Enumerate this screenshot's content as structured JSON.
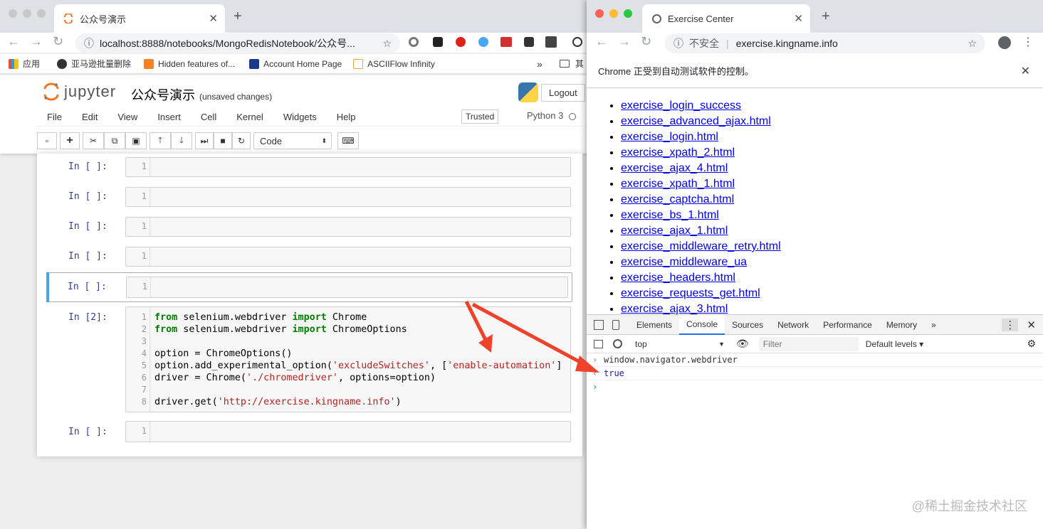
{
  "left": {
    "tab_title": "公众号演示",
    "url": "localhost:8888/notebooks/MongoRedisNotebook/公众号...",
    "bookmarks": [
      "应用",
      "亚马逊批量删除",
      "Hidden features of...",
      "Account Home Page",
      "ASCIIFlow Infinity"
    ],
    "bookmarks_more": "»",
    "other_bookmarks": "其",
    "jupyter": {
      "logo_text": "jupyter",
      "notebook_title": "公众号演示",
      "save_status": "(unsaved changes)",
      "logout": "Logout",
      "menu": [
        "File",
        "Edit",
        "View",
        "Insert",
        "Cell",
        "Kernel",
        "Widgets",
        "Help"
      ],
      "trusted": "Trusted",
      "kernel": "Python 3",
      "cell_type": "Code"
    },
    "cells": [
      {
        "prompt": "In [ ]:",
        "line": "1"
      },
      {
        "prompt": "In [ ]:",
        "line": "1"
      },
      {
        "prompt": "In [ ]:",
        "line": "1"
      },
      {
        "prompt": "In [ ]:",
        "line": "1"
      },
      {
        "prompt": "In [ ]:",
        "line": "1"
      },
      {
        "prompt": "In [2]:",
        "lines": [
          "1",
          "2",
          "3",
          "4",
          "5",
          "6",
          "7",
          "8"
        ]
      },
      {
        "prompt": "In [ ]:",
        "line": "1"
      }
    ],
    "code": {
      "l1_kw1": "from",
      "l1_mod": " selenium.webdriver ",
      "l1_kw2": "import",
      "l1_name": " Chrome",
      "l2_kw1": "from",
      "l2_mod": " selenium.webdriver ",
      "l2_kw2": "import",
      "l2_name": " ChromeOptions",
      "l4": "option = ChromeOptions()",
      "l5_a": "option.add_experimental_option(",
      "l5_s1": "'excludeSwitches'",
      "l5_b": ", [",
      "l5_s2": "'enable-automation'",
      "l5_c": "]",
      "l6_a": "driver = Chrome(",
      "l6_s": "'./chromedriver'",
      "l6_b": ", options=option)",
      "l8_a": "driver.get(",
      "l8_s": "'http://exercise.kingname.info'",
      "l8_b": ")"
    }
  },
  "right": {
    "tab_title": "Exercise Center",
    "insecure": "不安全",
    "url": "exercise.kingname.info",
    "infobar": "Chrome 正受到自动测试软件的控制。",
    "links": [
      "exercise_login_success",
      "exercise_advanced_ajax.html",
      "exercise_login.html",
      "exercise_xpath_2.html",
      "exercise_ajax_4.html",
      "exercise_xpath_1.html",
      "exercise_captcha.html",
      "exercise_bs_1.html",
      "exercise_ajax_1.html",
      "exercise_middleware_retry.html",
      "exercise_middleware_ua",
      "exercise_headers.html",
      "exercise_requests_get.html",
      "exercise_ajax_3.html"
    ],
    "devtools": {
      "tabs": [
        "Elements",
        "Console",
        "Sources",
        "Network",
        "Performance",
        "Memory"
      ],
      "more": "»",
      "active": "Console",
      "context": "top",
      "filter_placeholder": "Filter",
      "levels": "Default levels ▾",
      "console_input": "window.navigator.webdriver",
      "console_output": "true"
    }
  },
  "watermark": "@稀土掘金技术社区",
  "colors": {
    "arrow": "#f0412a",
    "link": "#0000ee",
    "jupyter_orange": "#f37726",
    "prompt": "#303f9f"
  }
}
